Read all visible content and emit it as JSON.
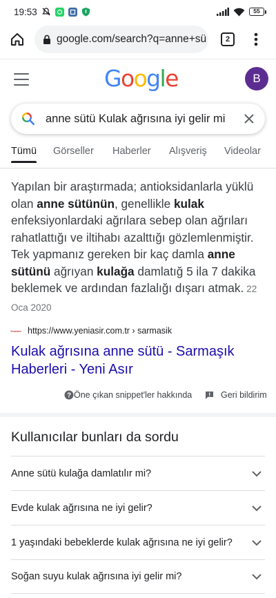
{
  "status_bar": {
    "time": "19:53",
    "battery": "55"
  },
  "browser": {
    "url": "google.com/search?q=anne+sü",
    "tab_count": "2"
  },
  "header": {
    "logo_letters": [
      {
        "ch": "G",
        "color": "#4285F4"
      },
      {
        "ch": "o",
        "color": "#EA4335"
      },
      {
        "ch": "o",
        "color": "#FBBC05"
      },
      {
        "ch": "g",
        "color": "#4285F4"
      },
      {
        "ch": "l",
        "color": "#34A853"
      },
      {
        "ch": "e",
        "color": "#EA4335"
      }
    ],
    "avatar_letter": "B"
  },
  "search": {
    "query": "anne sütü Kulak ağrısına iyi gelir mi"
  },
  "tabs": [
    "Tümü",
    "Görseller",
    "Haberler",
    "Alışveriş",
    "Videolar"
  ],
  "snippet": {
    "segments": [
      {
        "text": "Yapılan bir araştırmada; antioksidanlarla yüklü olan ",
        "bold": false
      },
      {
        "text": "anne sütünün",
        "bold": true
      },
      {
        "text": ", genellikle ",
        "bold": false
      },
      {
        "text": "kulak",
        "bold": true
      },
      {
        "text": " enfeksiyonlardaki ağrılara sebep olan ağrıları rahatlattığı ve iltihabı azalttığı gözlemlenmiştir. Tek yapmanız gereken bir kaç damla ",
        "bold": false
      },
      {
        "text": "anne sütünü",
        "bold": true
      },
      {
        "text": " ağrıyan ",
        "bold": false
      },
      {
        "text": "kulağa",
        "bold": true
      },
      {
        "text": " damlatığ 5 ila 7 dakika beklemek ve ardından fazlalığı dışarı atmak.",
        "bold": false
      }
    ],
    "date": "22 Oca 2020",
    "source_url": "https://www.yeniasir.com.tr › sarmasik",
    "favicon_text": "YeniAsir",
    "result_title": "Kulak ağrısına anne sütü - Sarmaşık Haberleri - Yeni Asır",
    "about_label": "Öne çıkan snippet'ler hakkında",
    "feedback_label": "Geri bildirim"
  },
  "people_also_ask": {
    "title": "Kullanıcılar bunları da sordu",
    "questions": [
      "Anne sütü kulağa damlatılır mi?",
      "Evde kulak ağrısına ne iyi gelir?",
      "1 yaşındaki bebeklerde kulak ağrısına ne iyi gelir?",
      "Soğan suyu kulak ağrısına iyi gelir mi?"
    ]
  },
  "colors": {
    "link": "#1a0dab",
    "avatar": "#5c2d91",
    "whatsapp": "#25D366",
    "shield": "#1ea362"
  }
}
